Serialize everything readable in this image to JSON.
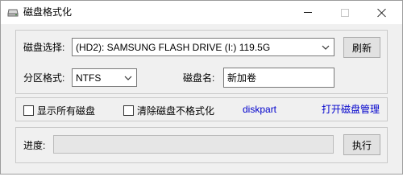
{
  "window": {
    "title": "磁盘格式化"
  },
  "disk": {
    "label": "磁盘选择:",
    "selected": "(HD2): SAMSUNG FLASH DRIVE (I:) 119.5G",
    "refresh_label": "刷新"
  },
  "format": {
    "partition_label": "分区格式:",
    "partition_value": "NTFS",
    "name_label": "磁盘名:",
    "name_value": "新加卷"
  },
  "options": {
    "show_all_label": "显示所有磁盘",
    "show_all_checked": false,
    "clear_unformat_label": "清除磁盘不格式化",
    "clear_unformat_checked": false,
    "diskpart_link": "diskpart",
    "disk_manage_link": "打开磁盘管理"
  },
  "progress": {
    "label": "进度:",
    "value": 0,
    "execute_label": "执行"
  }
}
